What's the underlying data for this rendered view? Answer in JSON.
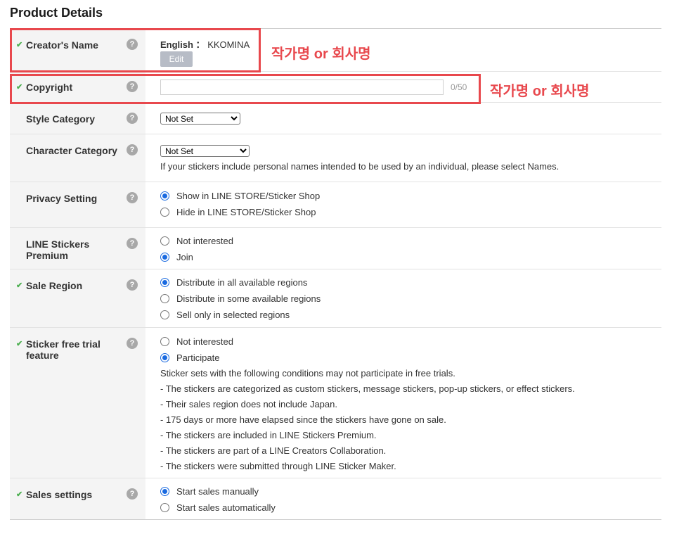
{
  "page_title": "Product Details",
  "creators_name": {
    "label": "Creator's Name",
    "language": "English ：",
    "value": "KKOMINA",
    "edit_label": "Edit"
  },
  "copyright": {
    "label": "Copyright",
    "value": "",
    "counter": "0/50"
  },
  "style_category": {
    "label": "Style Category",
    "selected": "Not Set"
  },
  "character_category": {
    "label": "Character Category",
    "selected": "Not Set",
    "note": "If your stickers include personal names intended to be used by an individual, please select Names."
  },
  "privacy_setting": {
    "label": "Privacy Setting",
    "options": [
      "Show in LINE STORE/Sticker Shop",
      "Hide in LINE STORE/Sticker Shop"
    ],
    "selected_index": 0
  },
  "premium": {
    "label_line1": "LINE Stickers",
    "label_line2": "Premium",
    "options": [
      "Not interested",
      "Join"
    ],
    "selected_index": 1
  },
  "sale_region": {
    "label": "Sale Region",
    "options": [
      "Distribute in all available regions",
      "Distribute in some available regions",
      "Sell only in selected regions"
    ],
    "selected_index": 0
  },
  "free_trial": {
    "label_line1": "Sticker free trial",
    "label_line2": "feature",
    "options": [
      "Not interested",
      "Participate"
    ],
    "selected_index": 1,
    "notes": [
      "Sticker sets with the following conditions may not participate in free trials.",
      "- The stickers are categorized as custom stickers, message stickers, pop-up stickers, or effect stickers.",
      "- Their sales region does not include Japan.",
      "- 175 days or more have elapsed since the stickers have gone on sale.",
      "- The stickers are included in LINE Stickers Premium.",
      "- The stickers are part of a LINE Creators Collaboration.",
      "- The stickers were submitted through LINE Sticker Maker."
    ]
  },
  "sales_settings": {
    "label": "Sales settings",
    "options": [
      "Start sales manually",
      "Start sales automatically"
    ],
    "selected_index": 0
  },
  "icons": {
    "check": "check-icon",
    "help": "question-mark-icon",
    "help_glyph": "?",
    "check_glyph": "✔"
  },
  "annotations": {
    "creator_note": "작가명 or 회사명",
    "copyright_note": "작가명 or 회사명",
    "color": "#e8484d"
  }
}
